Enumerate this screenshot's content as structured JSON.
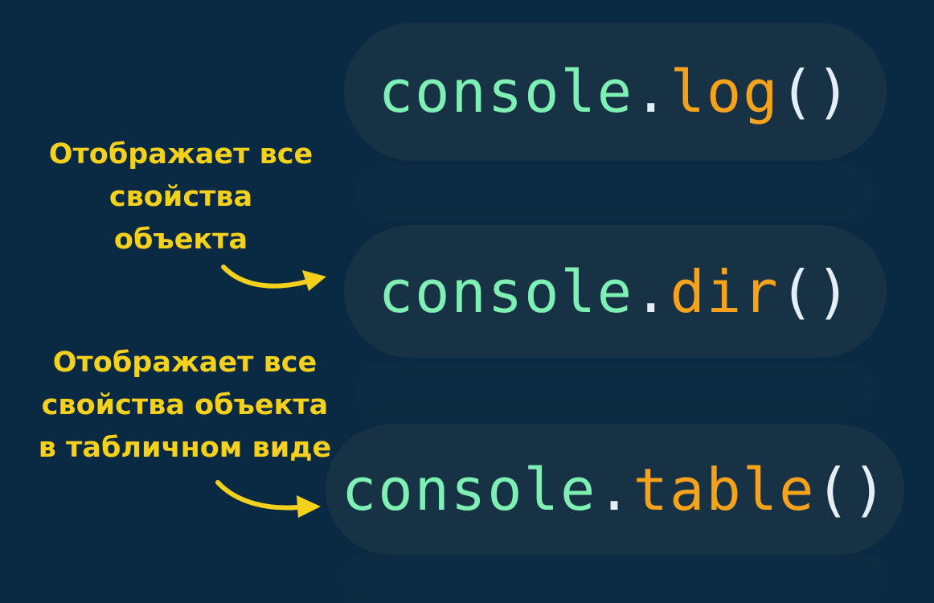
{
  "colors": {
    "background": "#0a2a43",
    "pill": "#173245",
    "object_text": "#7ef0b3",
    "method_text": "#f6a21b",
    "punctuation": "#e6eef5",
    "annotation": "#f5d11c"
  },
  "methods": [
    {
      "object": "console",
      "dot": ".",
      "name": "log",
      "parens": "()"
    },
    {
      "object": "console",
      "dot": ".",
      "name": "dir",
      "parens": "()"
    },
    {
      "object": "console",
      "dot": ".",
      "name": "table",
      "parens": "()"
    }
  ],
  "annotations": [
    {
      "lines": [
        "Отображает все",
        "свойства",
        "объекта"
      ],
      "icon": "curved-arrow-icon"
    },
    {
      "lines": [
        "Отображает все",
        "свойства объекта",
        "в табличном виде"
      ],
      "icon": "curved-arrow-icon"
    }
  ]
}
